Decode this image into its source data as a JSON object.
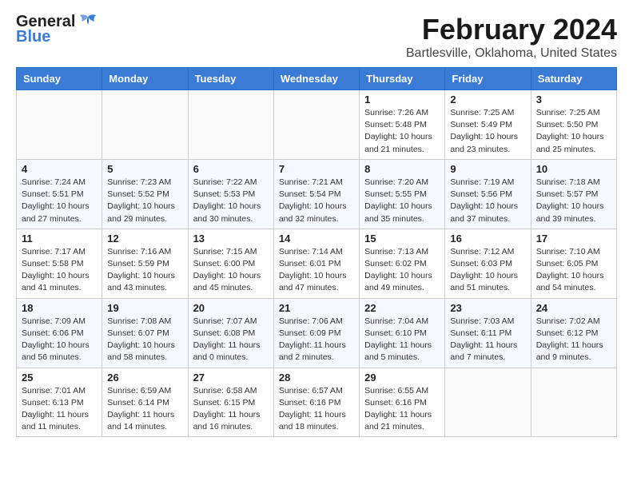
{
  "logo": {
    "general": "General",
    "blue": "Blue"
  },
  "header": {
    "month": "February 2024",
    "location": "Bartlesville, Oklahoma, United States"
  },
  "weekdays": [
    "Sunday",
    "Monday",
    "Tuesday",
    "Wednesday",
    "Thursday",
    "Friday",
    "Saturday"
  ],
  "weeks": [
    [
      {
        "day": "",
        "info": ""
      },
      {
        "day": "",
        "info": ""
      },
      {
        "day": "",
        "info": ""
      },
      {
        "day": "",
        "info": ""
      },
      {
        "day": "1",
        "info": "Sunrise: 7:26 AM\nSunset: 5:48 PM\nDaylight: 10 hours\nand 21 minutes."
      },
      {
        "day": "2",
        "info": "Sunrise: 7:25 AM\nSunset: 5:49 PM\nDaylight: 10 hours\nand 23 minutes."
      },
      {
        "day": "3",
        "info": "Sunrise: 7:25 AM\nSunset: 5:50 PM\nDaylight: 10 hours\nand 25 minutes."
      }
    ],
    [
      {
        "day": "4",
        "info": "Sunrise: 7:24 AM\nSunset: 5:51 PM\nDaylight: 10 hours\nand 27 minutes."
      },
      {
        "day": "5",
        "info": "Sunrise: 7:23 AM\nSunset: 5:52 PM\nDaylight: 10 hours\nand 29 minutes."
      },
      {
        "day": "6",
        "info": "Sunrise: 7:22 AM\nSunset: 5:53 PM\nDaylight: 10 hours\nand 30 minutes."
      },
      {
        "day": "7",
        "info": "Sunrise: 7:21 AM\nSunset: 5:54 PM\nDaylight: 10 hours\nand 32 minutes."
      },
      {
        "day": "8",
        "info": "Sunrise: 7:20 AM\nSunset: 5:55 PM\nDaylight: 10 hours\nand 35 minutes."
      },
      {
        "day": "9",
        "info": "Sunrise: 7:19 AM\nSunset: 5:56 PM\nDaylight: 10 hours\nand 37 minutes."
      },
      {
        "day": "10",
        "info": "Sunrise: 7:18 AM\nSunset: 5:57 PM\nDaylight: 10 hours\nand 39 minutes."
      }
    ],
    [
      {
        "day": "11",
        "info": "Sunrise: 7:17 AM\nSunset: 5:58 PM\nDaylight: 10 hours\nand 41 minutes."
      },
      {
        "day": "12",
        "info": "Sunrise: 7:16 AM\nSunset: 5:59 PM\nDaylight: 10 hours\nand 43 minutes."
      },
      {
        "day": "13",
        "info": "Sunrise: 7:15 AM\nSunset: 6:00 PM\nDaylight: 10 hours\nand 45 minutes."
      },
      {
        "day": "14",
        "info": "Sunrise: 7:14 AM\nSunset: 6:01 PM\nDaylight: 10 hours\nand 47 minutes."
      },
      {
        "day": "15",
        "info": "Sunrise: 7:13 AM\nSunset: 6:02 PM\nDaylight: 10 hours\nand 49 minutes."
      },
      {
        "day": "16",
        "info": "Sunrise: 7:12 AM\nSunset: 6:03 PM\nDaylight: 10 hours\nand 51 minutes."
      },
      {
        "day": "17",
        "info": "Sunrise: 7:10 AM\nSunset: 6:05 PM\nDaylight: 10 hours\nand 54 minutes."
      }
    ],
    [
      {
        "day": "18",
        "info": "Sunrise: 7:09 AM\nSunset: 6:06 PM\nDaylight: 10 hours\nand 56 minutes."
      },
      {
        "day": "19",
        "info": "Sunrise: 7:08 AM\nSunset: 6:07 PM\nDaylight: 10 hours\nand 58 minutes."
      },
      {
        "day": "20",
        "info": "Sunrise: 7:07 AM\nSunset: 6:08 PM\nDaylight: 11 hours\nand 0 minutes."
      },
      {
        "day": "21",
        "info": "Sunrise: 7:06 AM\nSunset: 6:09 PM\nDaylight: 11 hours\nand 2 minutes."
      },
      {
        "day": "22",
        "info": "Sunrise: 7:04 AM\nSunset: 6:10 PM\nDaylight: 11 hours\nand 5 minutes."
      },
      {
        "day": "23",
        "info": "Sunrise: 7:03 AM\nSunset: 6:11 PM\nDaylight: 11 hours\nand 7 minutes."
      },
      {
        "day": "24",
        "info": "Sunrise: 7:02 AM\nSunset: 6:12 PM\nDaylight: 11 hours\nand 9 minutes."
      }
    ],
    [
      {
        "day": "25",
        "info": "Sunrise: 7:01 AM\nSunset: 6:13 PM\nDaylight: 11 hours\nand 11 minutes."
      },
      {
        "day": "26",
        "info": "Sunrise: 6:59 AM\nSunset: 6:14 PM\nDaylight: 11 hours\nand 14 minutes."
      },
      {
        "day": "27",
        "info": "Sunrise: 6:58 AM\nSunset: 6:15 PM\nDaylight: 11 hours\nand 16 minutes."
      },
      {
        "day": "28",
        "info": "Sunrise: 6:57 AM\nSunset: 6:16 PM\nDaylight: 11 hours\nand 18 minutes."
      },
      {
        "day": "29",
        "info": "Sunrise: 6:55 AM\nSunset: 6:16 PM\nDaylight: 11 hours\nand 21 minutes."
      },
      {
        "day": "",
        "info": ""
      },
      {
        "day": "",
        "info": ""
      }
    ]
  ]
}
